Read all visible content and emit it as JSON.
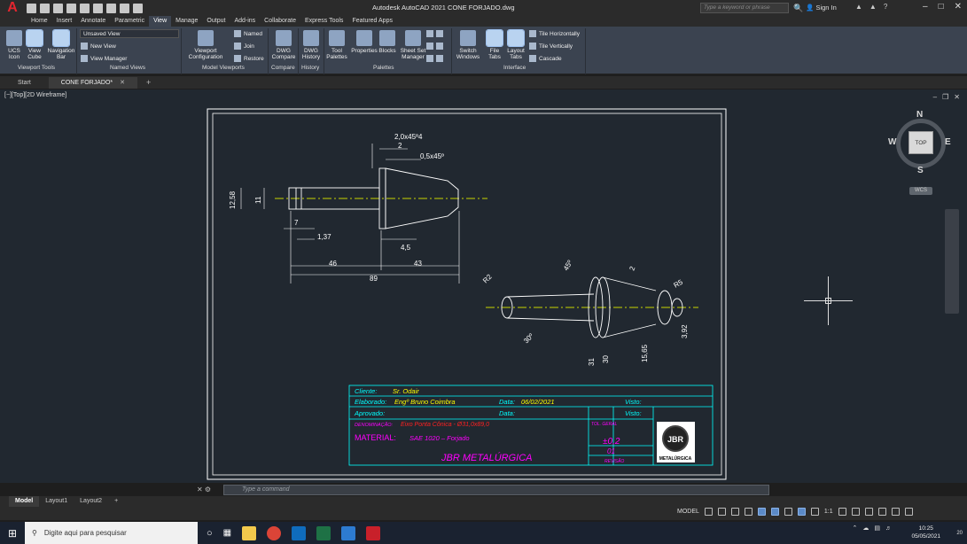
{
  "app": {
    "title": "Autodesk AutoCAD 2021   CONE FORJADO.dwg",
    "search_placeholder": "Type a keyword or phrase",
    "sign_in": "Sign In",
    "logo": "A"
  },
  "ribbon_tabs": [
    "Home",
    "Insert",
    "Annotate",
    "Parametric",
    "View",
    "Manage",
    "Output",
    "Add-ins",
    "Collaborate",
    "Express Tools",
    "Featured Apps"
  ],
  "active_ribbon_tab": "View",
  "ribbon": {
    "ucs_icon": "UCS Icon",
    "view_cube": "View Cube",
    "navigation_bar": "Navigation Bar",
    "view_dropdown": "Unsaved View",
    "new_view": "New View",
    "view_manager": "View Manager",
    "viewport_config": "Viewport Configuration",
    "named": "Named",
    "join": "Join",
    "restore": "Restore",
    "dwg_compare": "DWG Compare",
    "dwg_history": "DWG History",
    "tool_palettes": "Tool Palettes",
    "properties": "Properties",
    "blocks": "Blocks",
    "sheet_set_manager": "Sheet Set Manager",
    "switch_windows": "Switch Windows",
    "file_tabs": "File Tabs",
    "layout_tabs": "Layout Tabs",
    "tile_horizontally": "Tile Horizontally",
    "tile_vertically": "Tile Vertically",
    "cascade": "Cascade",
    "panel_labels": {
      "viewport_tools": "Viewport Tools",
      "named_views": "Named Views",
      "model_viewports": "Model Viewports",
      "compare": "Compare",
      "history": "History",
      "palettes": "Palettes",
      "interface": "Interface"
    }
  },
  "doc_tabs": {
    "start": "Start",
    "active": "CONE FORJADO*"
  },
  "viewport": {
    "label": "[−][Top][2D Wireframe]",
    "compass": {
      "n": "N",
      "s": "S",
      "e": "E",
      "w": "W",
      "top": "TOP"
    },
    "wcs": "WCS"
  },
  "drawing": {
    "dims_top": {
      "chamfer1": "2,0x45º4",
      "d2": "2",
      "chamfer2": "0,5x45º",
      "d1258": "12,58",
      "d11": "11",
      "d7": "7",
      "d137": "1,37",
      "d45": "4,5",
      "d46": "46",
      "d43": "43",
      "d89": "89"
    },
    "dims_iso": {
      "r2": "R2",
      "a45": "45º",
      "d2": "2",
      "r5": "R5",
      "a30": "30º",
      "d31": "31",
      "d30": "30",
      "d1565": "15,65",
      "d392": "3,92"
    }
  },
  "title_block": {
    "cliente_label": "Cliente:",
    "cliente_value": "Sr. Odair",
    "elaborado_label": "Elaborado:",
    "elaborado_value": "Engº Bruno Coimbra",
    "data_label": "Data:",
    "data_value": "06/02/2021",
    "visto_label": "Visto:",
    "aprovado_label": "Aprovado:",
    "data2_label": "Data:",
    "visto2_label": "Visto:",
    "denominacao_label": "DENOMINAÇÃO:",
    "denominacao_value": "Eixo Ponta Cônica - Ø31,0x89,0",
    "tol_label": "TOL. GERAL",
    "tol_value": "±0,2",
    "material_label": "MATERIAL:",
    "material_value": "SAE 1020 – Forjado",
    "revisao_value": "01",
    "revisao_label": "REVISÃO",
    "company": "JBR METALÚRGICA",
    "logo_text": "JBR",
    "logo_sub": "METALÚRGICA"
  },
  "command_line": {
    "placeholder": "Type a command"
  },
  "layout_tabs": [
    "Model",
    "Layout1",
    "Layout2"
  ],
  "status": {
    "model": "MODEL",
    "scale": "1:1"
  },
  "taskbar": {
    "search": "Digite aqui para pesquisar",
    "time": "10:25",
    "date": "05/05/2021",
    "notifications": "20"
  },
  "colors": {
    "accent_cyan": "#00ffff",
    "magenta": "#ff00ff",
    "red": "#ff2020",
    "yellow": "#ffff00",
    "green_centerline": "#c8d400"
  }
}
